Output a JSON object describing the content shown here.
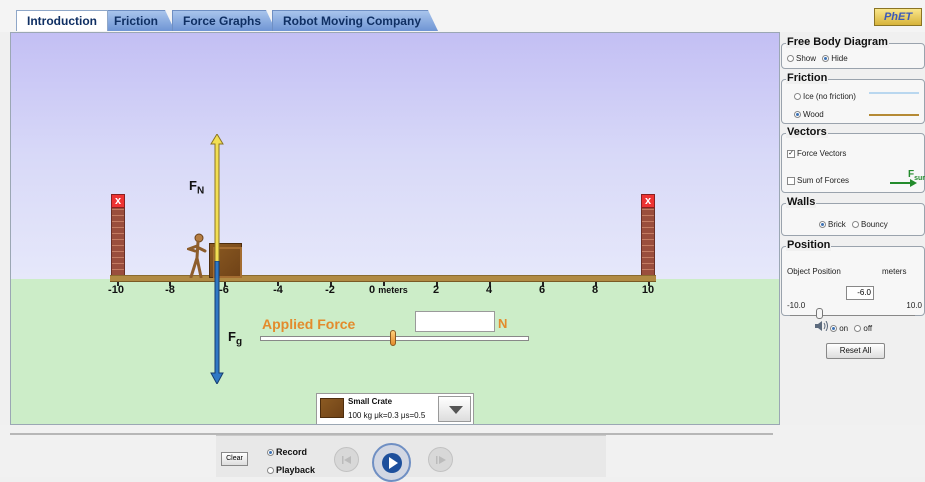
{
  "tabs": [
    {
      "label": "Introduction",
      "active": true
    },
    {
      "label": "Friction",
      "active": false
    },
    {
      "label": "Force Graphs",
      "active": false
    },
    {
      "label": "Robot Moving Company",
      "active": false
    }
  ],
  "logo": "PhET",
  "scene": {
    "ticks": [
      "-10",
      "-8",
      "-6",
      "-4",
      "-2",
      "0",
      "2",
      "4",
      "6",
      "8",
      "10"
    ],
    "meters": "meters",
    "wall_marker": "x",
    "normal_force": {
      "base": "F",
      "sub": "N"
    },
    "gravity_force": {
      "base": "F",
      "sub": "g"
    },
    "applied_force_label": "Applied Force",
    "applied_force_value": "",
    "force_unit": "N",
    "applied_force_fraction": 0.5,
    "object_position": -6.0
  },
  "object_selector": {
    "name": "Small Crate",
    "details": "100 kg μk=0.3 μs=0.5"
  },
  "panels": {
    "free_body": {
      "title": "Free Body Diagram",
      "show": "Show",
      "hide": "Hide",
      "selected": "Hide"
    },
    "friction": {
      "title": "Friction",
      "ice": "Ice (no friction)",
      "wood": "Wood",
      "selected": "Wood"
    },
    "vectors": {
      "title": "Vectors",
      "force_vectors": "Force Vectors",
      "force_vectors_checked": true,
      "sum_of_forces": "Sum of Forces",
      "sum_of_forces_checked": false,
      "sum_label": {
        "base": "F",
        "sub": "sum"
      }
    },
    "walls": {
      "title": "Walls",
      "brick": "Brick",
      "bouncy": "Bouncy",
      "selected": "Brick"
    },
    "position": {
      "title": "Position",
      "label": "Object Position",
      "value": "-6.0",
      "unit": "meters",
      "min": "-10.0",
      "max": "10.0"
    },
    "sound": {
      "on": "on",
      "off": "off",
      "selected": "on"
    },
    "reset_all": "Reset All"
  },
  "playback": {
    "clear": "Clear",
    "record": "Record",
    "playback": "Playback",
    "selected": "Record"
  },
  "colors": {
    "accent_orange": "#e38b2c",
    "normal_force": "#f2df53",
    "gravity_force": "#2f78c5",
    "play_blue": "#1d4f9c"
  }
}
